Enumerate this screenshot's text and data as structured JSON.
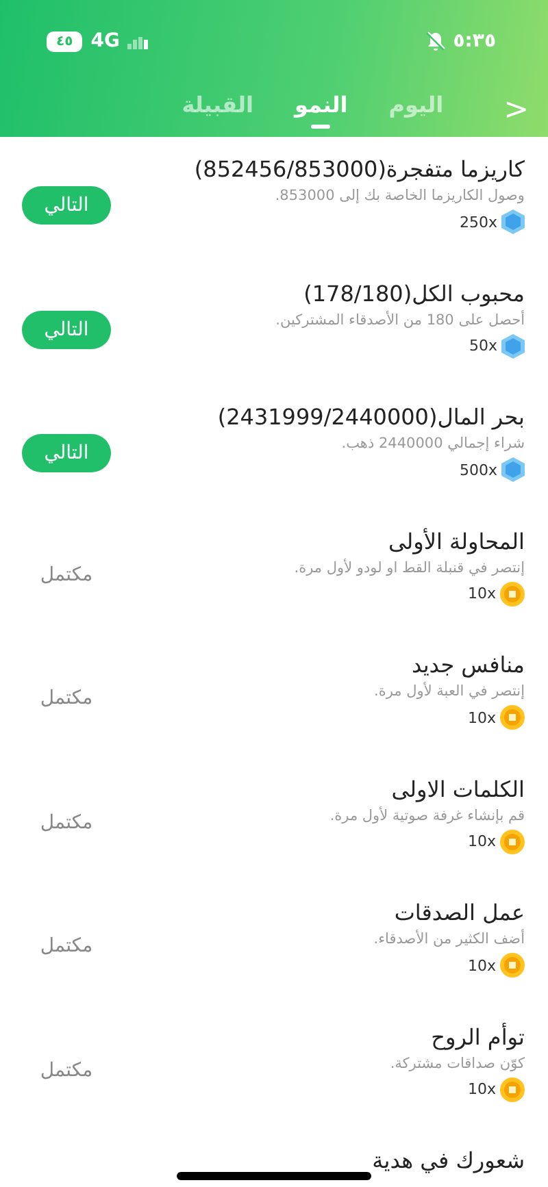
{
  "status_bar": {
    "time": "٥:٣٥",
    "muted": true,
    "network": "4G",
    "battery": "٤٥"
  },
  "header": {
    "back": "<",
    "tabs": [
      {
        "label": "اليوم",
        "selected": false
      },
      {
        "label": "النمو",
        "selected": true
      },
      {
        "label": "القبيلة",
        "selected": false
      }
    ]
  },
  "tasks": [
    {
      "title": "كاريزما متفجرة(852456/853000)",
      "description": "وصول الكاريزما الخاصة بك إلى 853000.",
      "reward": {
        "kind": "exp",
        "amount": "250x"
      },
      "action": {
        "kind": "button",
        "label": "التالي"
      }
    },
    {
      "title": "محبوب الكل(178/180)",
      "description": "أحصل على 180 من الأصدقاء المشتركين.",
      "reward": {
        "kind": "exp",
        "amount": "50x"
      },
      "action": {
        "kind": "button",
        "label": "التالي"
      }
    },
    {
      "title": "بحر المال(2431999/2440000)",
      "description": "شراء إجمالي 2440000 ذهب.",
      "reward": {
        "kind": "exp",
        "amount": "500x"
      },
      "action": {
        "kind": "button",
        "label": "التالي"
      }
    },
    {
      "title": "المحاولة الأولى",
      "description": "إنتصر في قنبلة القط او لودو لأول مرة.",
      "reward": {
        "kind": "coin",
        "amount": "10x"
      },
      "action": {
        "kind": "status",
        "label": "مكتمل"
      }
    },
    {
      "title": "منافس جديد",
      "description": "إنتصر في العبة لأول مرة.",
      "reward": {
        "kind": "coin",
        "amount": "10x"
      },
      "action": {
        "kind": "status",
        "label": "مكتمل"
      }
    },
    {
      "title": "الكلمات الاولى",
      "description": "قم بإنشاء غرفة صوتية لأول مرة.",
      "reward": {
        "kind": "coin",
        "amount": "10x"
      },
      "action": {
        "kind": "status",
        "label": "مكتمل"
      }
    },
    {
      "title": "عمل الصدقات",
      "description": "أضف الكثير من الأصدقاء.",
      "reward": {
        "kind": "coin",
        "amount": "10x"
      },
      "action": {
        "kind": "status",
        "label": "مكتمل"
      }
    },
    {
      "title": "توأم الروح",
      "description": "كوّن صداقات مشتركة.",
      "reward": {
        "kind": "coin",
        "amount": "10x"
      },
      "action": {
        "kind": "status",
        "label": "مكتمل"
      }
    },
    {
      "title": "شعورك في هدية"
    }
  ]
}
